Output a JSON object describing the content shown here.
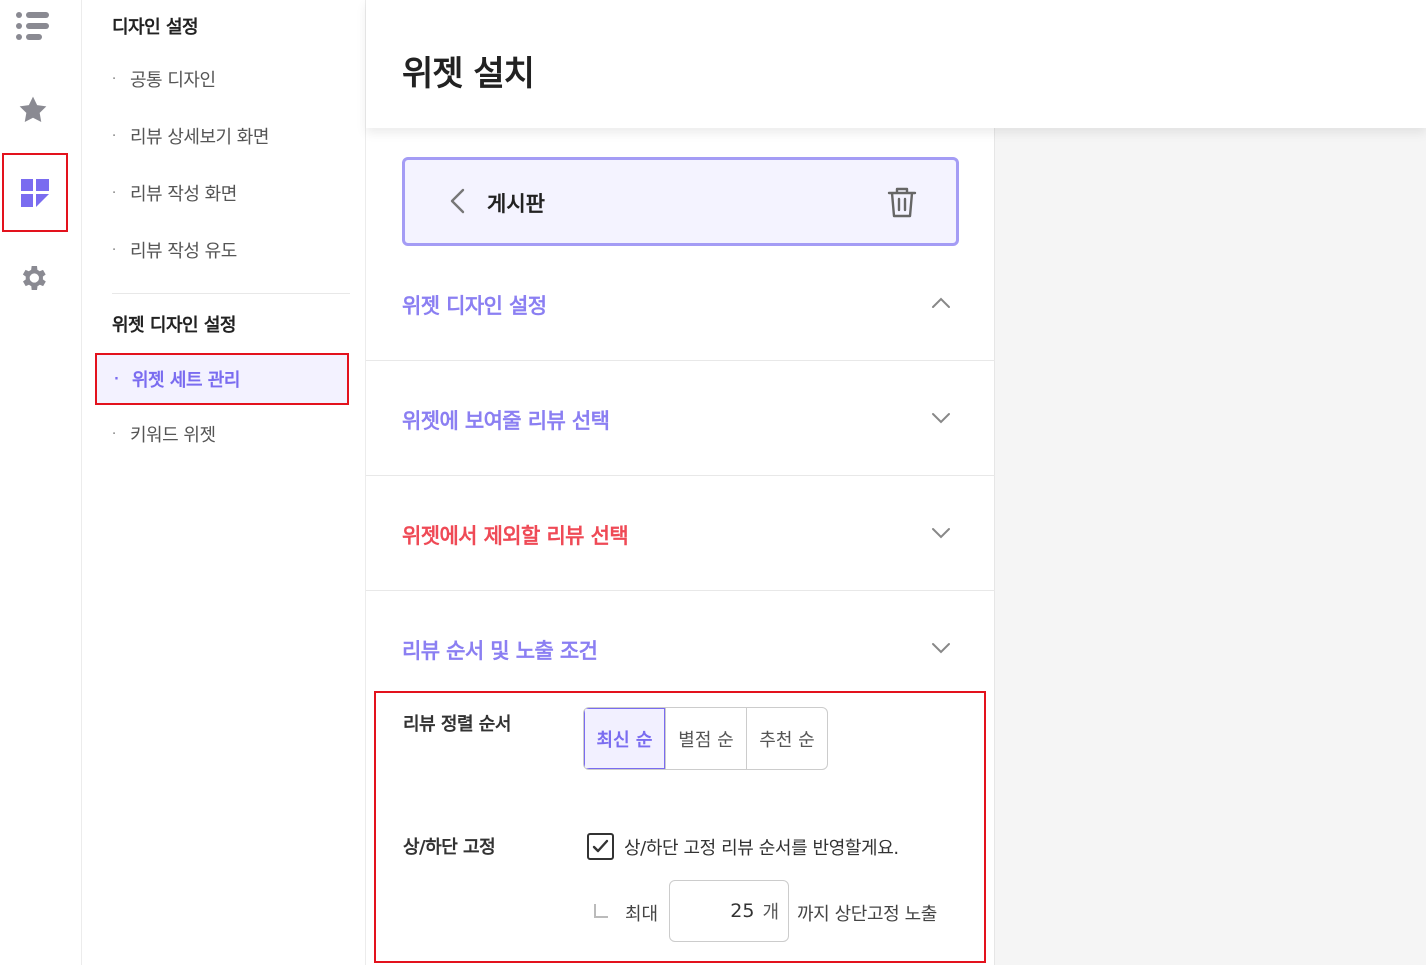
{
  "rail": {
    "icons": [
      "list-icon",
      "star-icon",
      "dashboard-icon",
      "gear-icon"
    ],
    "active_index": 2
  },
  "subnav": {
    "design_heading": "디자인 설정",
    "design_items": [
      "공통 디자인",
      "리뷰 상세보기 화면",
      "리뷰 작성 화면",
      "리뷰 작성 유도"
    ],
    "widget_heading": "위젯 디자인 설정",
    "widget_items": [
      "위젯 세트 관리",
      "키워드 위젯"
    ],
    "bullet": "·"
  },
  "header": {
    "title": "위젯 설치"
  },
  "board": {
    "label": "게시판"
  },
  "accordions": [
    {
      "title": "위젯 디자인 설정",
      "state": "expanded"
    },
    {
      "title": "위젯에 보여줄 리뷰 선택",
      "state": "collapsed"
    },
    {
      "title": "위젯에서 제외할 리뷰 선택",
      "state": "collapsed"
    },
    {
      "title": "리뷰 순서 및 노출 조건",
      "state": "collapsed"
    }
  ],
  "sort": {
    "label": "리뷰 정렬 순서",
    "options": [
      "최신 순",
      "별점 순",
      "추천 순"
    ],
    "selected": 0
  },
  "pin": {
    "label": "상/하단 고정",
    "checkbox_text": "상/하단 고정 리뷰 순서를 반영할게요.",
    "checked": true,
    "max_label": "최대",
    "max_value": "25",
    "unit": "개",
    "suffix": "까지 상단고정 노출"
  },
  "colors": {
    "accent": "#7a6cf0",
    "danger": "#ef4a56",
    "highlight": "#e3121d"
  }
}
